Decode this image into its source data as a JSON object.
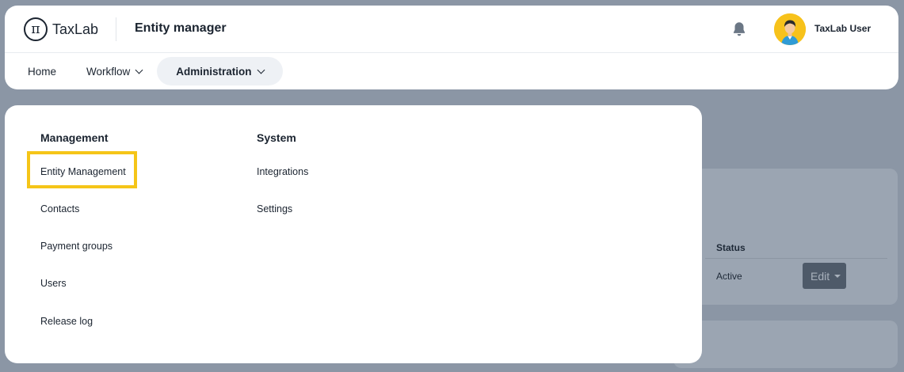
{
  "app": {
    "logo_text": "TaxLab",
    "logo_glyph": "π",
    "page_title": "Entity manager"
  },
  "user": {
    "name": "TaxLab User"
  },
  "nav": {
    "items": [
      {
        "label": "Home"
      },
      {
        "label": "Workflow"
      },
      {
        "label": "Administration"
      }
    ]
  },
  "dropdown": {
    "management": {
      "heading": "Management",
      "links": [
        "Entity Management",
        "Contacts",
        "Payment groups",
        "Users",
        "Release log"
      ]
    },
    "system": {
      "heading": "System",
      "links": [
        "Integrations",
        "Settings"
      ]
    }
  },
  "background": {
    "status_header": "Status",
    "status_value": "Active",
    "edit_label": "Edit"
  },
  "colors": {
    "highlight": "#f5c518",
    "avatar_bg": "#f7c21b",
    "overlay": "#8b96a5"
  },
  "icons": {
    "bell": "bell-icon",
    "chevron": "chevron-down-icon"
  }
}
